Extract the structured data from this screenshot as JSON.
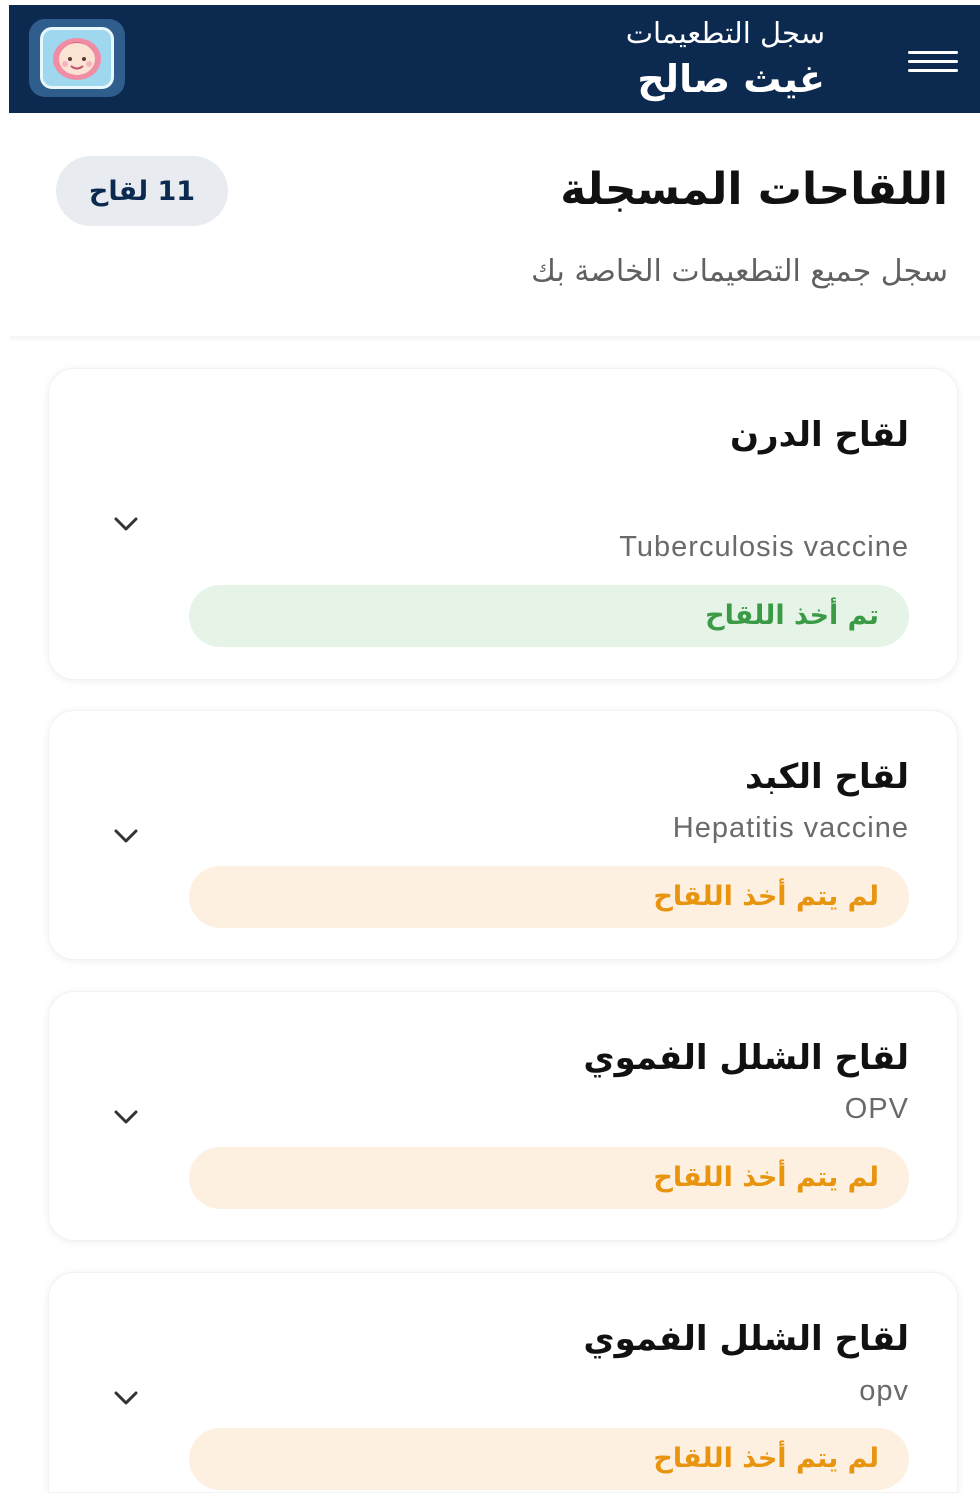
{
  "header": {
    "subtitle": "سجل التطعيمات",
    "name": "غيث صالح"
  },
  "page": {
    "title": "اللقاحات المسجلة",
    "subtitle": "سجل جميع التطعيمات الخاصة بك",
    "count_badge": "11 لقاح"
  },
  "vaccines": [
    {
      "name": "لقاح الدرن",
      "english": "Tuberculosis vaccine",
      "status": "تم أخذ اللقاح"
    },
    {
      "name": "لقاح الكبد",
      "english": "Hepatitis vaccine",
      "status": "لم يتم أخذ اللقاح"
    },
    {
      "name": "لقاح الشلل الفموي",
      "english": "OPV",
      "status": "لم يتم أخذ اللقاح"
    },
    {
      "name": "لقاح الشلل الفموي",
      "english": "opv",
      "status": "لم يتم أخذ اللقاح"
    }
  ],
  "colors": {
    "header_bg": "#0c2a4f",
    "status_done_text": "#3a9a45",
    "status_done_bg": "#e6f4e8",
    "status_pending_text": "#e8940e",
    "status_pending_bg": "#fdf0e1"
  },
  "icons": {
    "menu": "hamburger-menu-icon",
    "logo": "baby-logo-icon",
    "expand": "chevron-down-icon"
  }
}
